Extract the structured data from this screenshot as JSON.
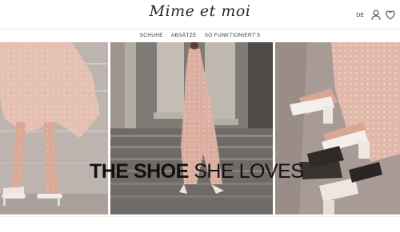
{
  "header": {
    "logo_text": "Mime et moi",
    "language": "DE"
  },
  "nav": {
    "items": [
      {
        "label": "SCHUHE"
      },
      {
        "label": "ABSÄTZE"
      },
      {
        "label": "SO FUNKTIONIERT'S"
      }
    ]
  },
  "hero": {
    "headline_bold": "THE SHOE",
    "headline_regular": "SHE LOVES"
  },
  "icons": {
    "account": "user-icon",
    "wishlist": "heart-icon"
  }
}
